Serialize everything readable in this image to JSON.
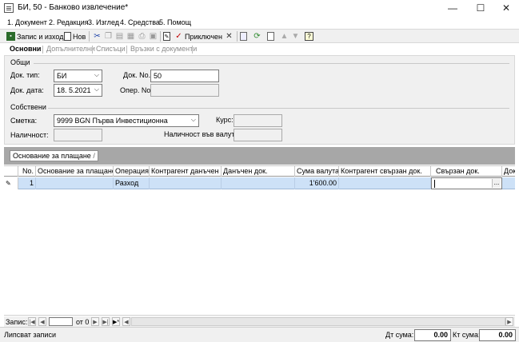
{
  "window": {
    "title": "БИ, 50 - Банково извлечение*",
    "minimize": "—",
    "maximize": "☐",
    "close": "✕"
  },
  "menu": [
    "1. Документ",
    "2. Редакция",
    "3. Изглед",
    "4. Средства",
    "5. Помощ"
  ],
  "toolbar": {
    "save_and_exit": "Запис и изход",
    "new": "Нов",
    "finished": "Приключен"
  },
  "tabs": [
    "Основни",
    "Допълнителни",
    "Списъци",
    "Връзки с документи"
  ],
  "form": {
    "group_general": "Общи",
    "doc_type_label": "Док. тип:",
    "doc_type_value": "БИ",
    "doc_no_label": "Док. No.",
    "doc_no_value": "50",
    "doc_date_label": "Док. дата:",
    "doc_date_value": "18.  5.2021",
    "oper_no_label": "Опер. No.",
    "oper_no_value": "",
    "group_own": "Собствени",
    "account_label": "Сметка:",
    "account_value": "9999 BGN Първа Инвестиционна",
    "rate_label": "Курс:",
    "rate_value": "",
    "availability_label": "Наличност:",
    "availability_value": "",
    "availability_cur_label": "Наличност във валута:",
    "availability_cur_value": ""
  },
  "grid": {
    "group_chip": "Основание за плащане",
    "group_chip_sort": "/",
    "columns": [
      "No.",
      "Основание за плащане /",
      "Операция",
      "Контрагент данъчен д...",
      "Данъчен док.",
      "Сума валута",
      "Контрагент свързан док.",
      "Свързан док.",
      "Док"
    ],
    "rows": [
      {
        "no": "1",
        "basis": "",
        "operation": "Разход",
        "counterparty_tax": "",
        "tax_doc": "",
        "amount": "1'600.00",
        "counterparty_linked": "",
        "linked_doc": "",
        "doc": ""
      }
    ],
    "ellipsis": "..."
  },
  "navigator": {
    "record_label": "Запис:",
    "record_value": "",
    "of_label": "от 0"
  },
  "status": {
    "message": "Липсват записи",
    "debit_label": "Дт сума:",
    "debit_value": "0.00",
    "credit_label": "Кт сума:",
    "credit_value": "0.00"
  }
}
